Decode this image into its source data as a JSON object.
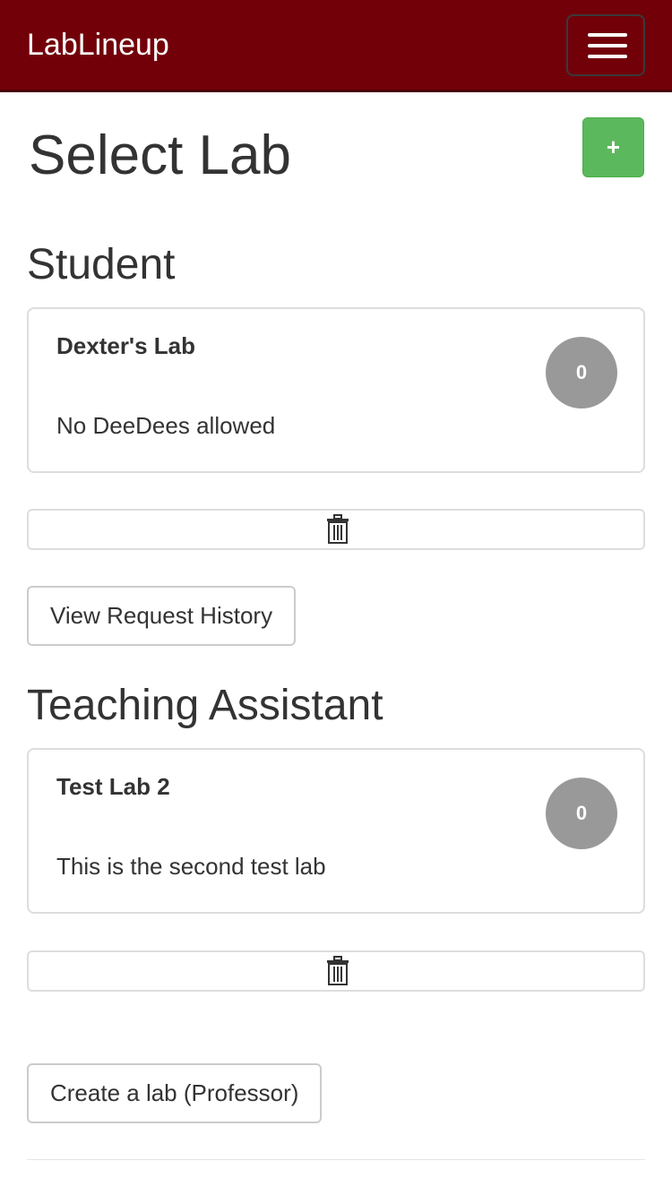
{
  "navbar": {
    "brand": "LabLineup",
    "menu_icon": "hamburger-icon"
  },
  "page": {
    "title": "Select Lab",
    "add_label": "+"
  },
  "student": {
    "heading": "Student",
    "lab": {
      "title": "Dexter's Lab",
      "description": "No DeeDees allowed",
      "count": "0"
    },
    "history_label": "View Request History"
  },
  "ta": {
    "heading": "Teaching Assistant",
    "lab": {
      "title": "Test Lab 2",
      "description": "This is the second test lab",
      "count": "0"
    }
  },
  "footer": {
    "create_label": "Create a lab (Professor)"
  },
  "colors": {
    "navbar": "#720009",
    "success": "#5cb85c",
    "badge": "#999999"
  }
}
